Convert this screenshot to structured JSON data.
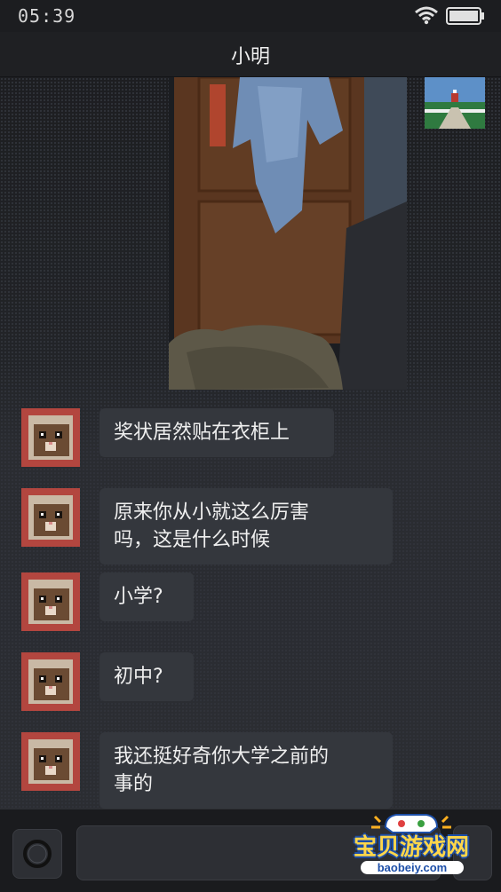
{
  "status": {
    "time": "05:39"
  },
  "header": {
    "title": "小明"
  },
  "messages": [
    {
      "sender": "小明",
      "lines": [
        "奖状居然贴在衣柜上"
      ]
    },
    {
      "sender": "小明",
      "lines": [
        "原来你从小就这么厉害",
        "吗，这是什么时候"
      ]
    },
    {
      "sender": "小明",
      "lines": [
        "小学?"
      ]
    },
    {
      "sender": "小明",
      "lines": [
        "初中?"
      ]
    },
    {
      "sender": "小明",
      "lines": [
        "我还挺好奇你大学之前的",
        "事的"
      ]
    }
  ],
  "input": {
    "value": ""
  },
  "watermark": {
    "name": "宝贝游戏网",
    "url": "baobeiy.com"
  },
  "colors": {
    "background": "#26282c",
    "bubble": "#34373d",
    "avatar_frame": "#b3463f"
  },
  "icons": {
    "wifi": "wifi-icon",
    "battery": "battery-icon",
    "camera": "camera-icon"
  }
}
